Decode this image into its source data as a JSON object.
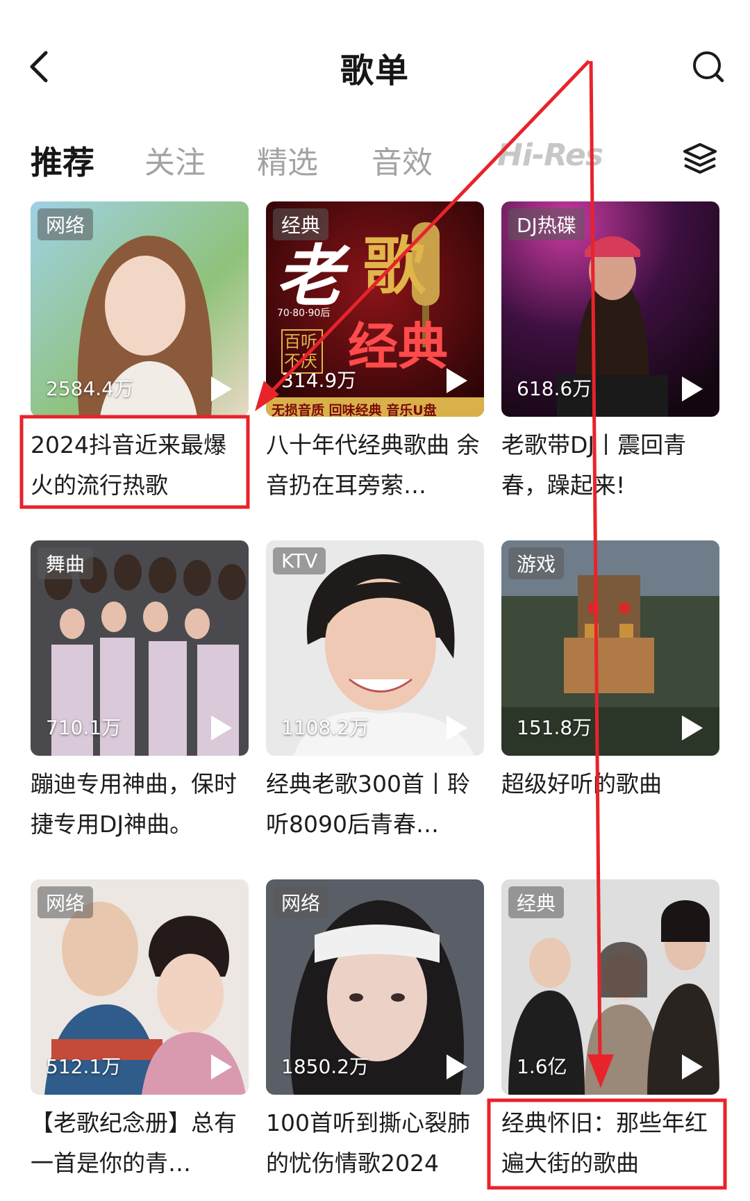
{
  "header": {
    "title": "歌单"
  },
  "tabs": [
    {
      "label": "推荐",
      "active": true
    },
    {
      "label": "关注",
      "active": false
    },
    {
      "label": "精选",
      "active": false
    },
    {
      "label": "音效",
      "active": false
    },
    {
      "label": "Hi-Res",
      "active": false
    }
  ],
  "icons": {
    "back": "chevron-left-icon",
    "search": "search-icon",
    "layers": "layers-icon",
    "play": "play-icon"
  },
  "colors": {
    "highlight": "#e8232b",
    "tag_bg": "#5a5a5a"
  },
  "playlists": [
    {
      "tag": "网络",
      "plays": "2584.4万",
      "title": "2024抖音近来最爆火的流行热歌",
      "highlighted": true
    },
    {
      "tag": "经典",
      "plays": "314.9万",
      "title": "八十年代经典歌曲 余音扔在耳旁萦…",
      "highlighted": false,
      "cover_text": {
        "big1": "老",
        "big2": "歌",
        "big3": "经典",
        "sub": "70·80·90后",
        "side": "百听不厌",
        "bottom": "无损音质 回味经典 音乐U盘"
      }
    },
    {
      "tag": "DJ热碟",
      "plays": "618.6万",
      "title": "老歌带DJ丨震回青春，躁起来!",
      "highlighted": false
    },
    {
      "tag": "舞曲",
      "plays": "710.1万",
      "title": "蹦迪专用神曲，保时捷专用DJ神曲。",
      "highlighted": false
    },
    {
      "tag": "KTV",
      "plays": "1108.2万",
      "title": "经典老歌300首丨聆听8090后青春…",
      "highlighted": false
    },
    {
      "tag": "游戏",
      "plays": "151.8万",
      "title": "超级好听的歌曲",
      "highlighted": false
    },
    {
      "tag": "网络",
      "plays": "512.1万",
      "title": "【老歌纪念册】总有一首是你的青…",
      "highlighted": false
    },
    {
      "tag": "网络",
      "plays": "1850.2万",
      "title": "100首听到撕心裂肺的忧伤情歌2024",
      "highlighted": false
    },
    {
      "tag": "经典",
      "plays": "1.6亿",
      "title": "经典怀旧：那些年红遍大街的歌曲",
      "highlighted": true
    }
  ]
}
